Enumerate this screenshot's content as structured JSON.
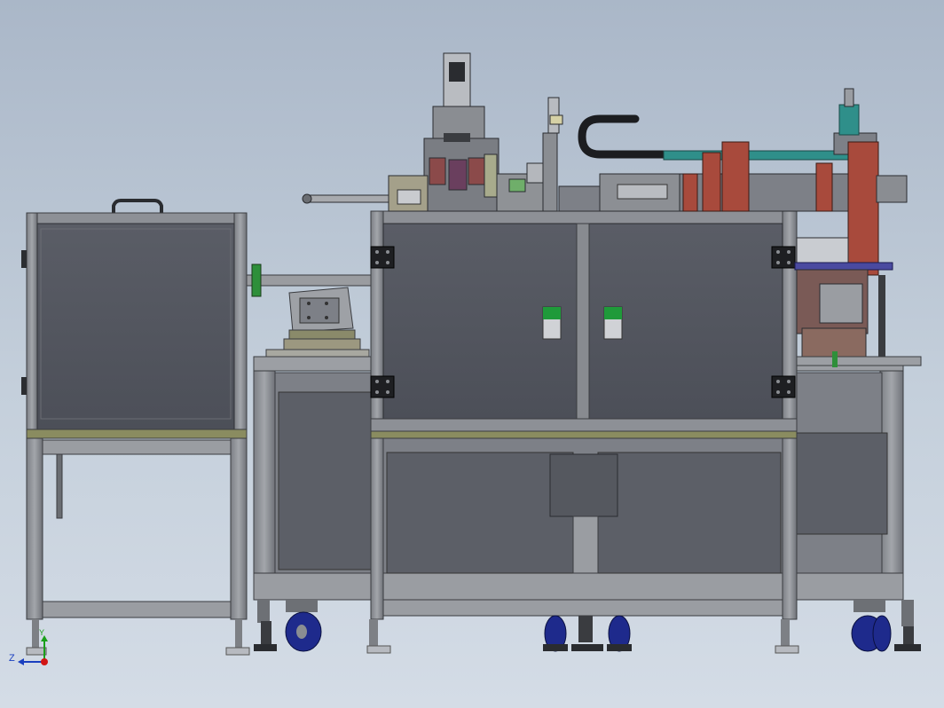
{
  "view": {
    "background_top": "#aab7c8",
    "background_bottom": "#d4dce6"
  },
  "triad": {
    "x_axis_label": "",
    "y_axis_label": "Y",
    "z_axis_label": "Z",
    "x_color": "#d21414",
    "y_color": "#1aa01a",
    "z_color": "#1a3fbf"
  },
  "machine": {
    "frame_color": "#8a8c90",
    "panel_color": "#53565f",
    "accent_red": "#a84a3c",
    "accent_teal": "#2f8f8a",
    "indicator_green": "#1f9a3a",
    "caster_blue": "#1e2a8c"
  }
}
